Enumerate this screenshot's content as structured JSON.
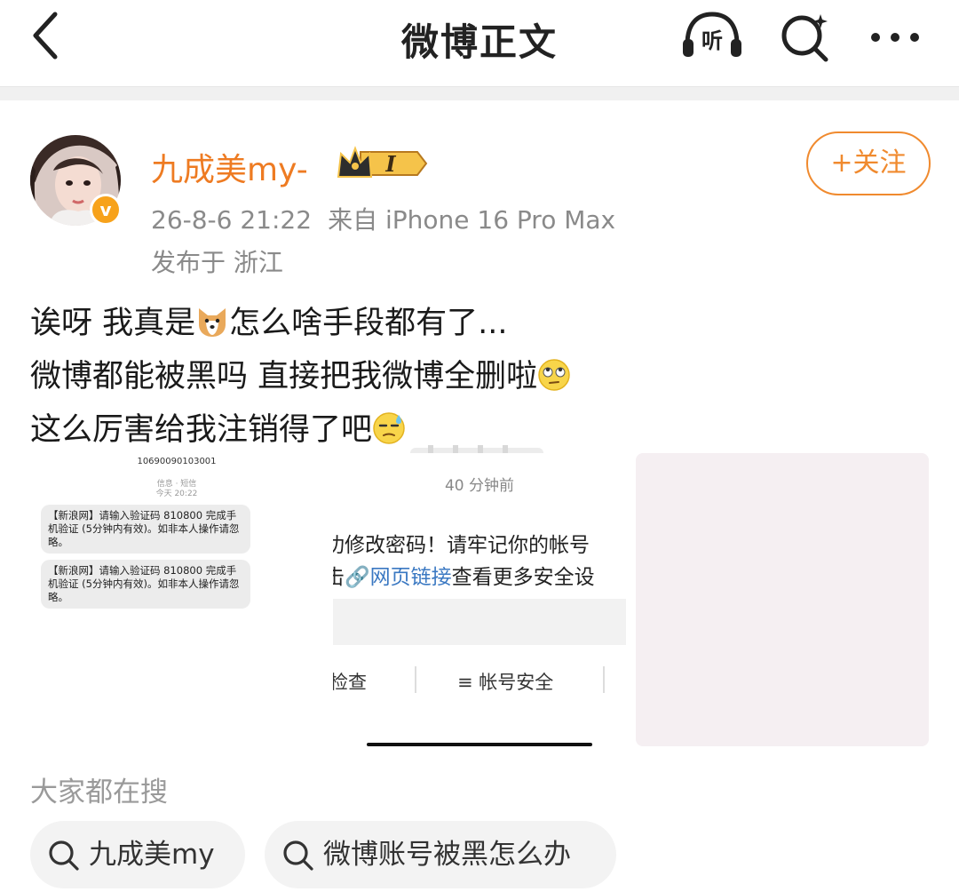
{
  "nav": {
    "title": "微博正文",
    "listen_label": "听"
  },
  "post": {
    "username": "九成美my-",
    "vip_level": "I",
    "verified_badge": "v",
    "date": "26-8-6 21:22",
    "source": "来自 iPhone 16 Pro Max",
    "location": "发布于 浙江",
    "follow_label": "+关注",
    "lines": [
      {
        "before": "诶呀 我真是",
        "emoji": "dog-emoji",
        "after": "怎么啥手段都有了..."
      },
      {
        "before": "微博都能被黑吗 直接把我微博全删啦",
        "emoji": "eye-roll-emoji",
        "after": ""
      },
      {
        "before": "这么厉害给我注销得了吧",
        "emoji": "sweat-emoji",
        "after": ""
      }
    ]
  },
  "images": {
    "sms": {
      "number": "10690090103001",
      "meta_line1": "信息 · 短信",
      "meta_line2": "今天 20:22",
      "messages": [
        "【新浪网】请输入验证码 810800 完成手机验证 (5分钟内有效)。如非本人操作请忽略。",
        "【新浪网】请输入验证码 810800 完成手机验证 (5分钟内有效)。如非本人操作请忽略。"
      ]
    },
    "notice": {
      "time": "40 分钟前",
      "text_line1": "功修改密码！请牢记你的帐号",
      "text_line2_prefix": "击",
      "text_line2_link": "🔗网页链接",
      "text_line2_suffix": "查看更多安全设",
      "tab_left": "检查",
      "tab_right": "≡ 帐号安全"
    }
  },
  "hot_search": {
    "title": "大家都在搜",
    "items": [
      "九成美my",
      "微博账号被黑怎么办"
    ]
  },
  "colors": {
    "accent_orange": "#ee7b22",
    "meta_gray": "#8a8a8a",
    "link_blue": "#3a78c2"
  }
}
